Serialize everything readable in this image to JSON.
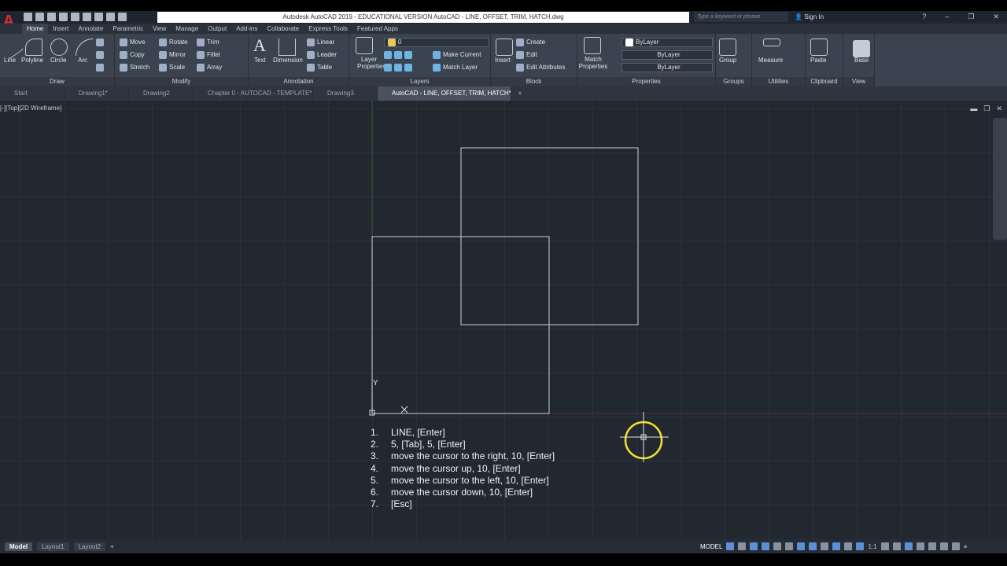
{
  "titlebar": {
    "doc_title": "Autodesk AutoCAD 2019 - EDUCATIONAL VERSION    AutoCAD - LINE, OFFSET, TRIM, HATCH.dwg",
    "search_placeholder": "Type a keyword or phrase",
    "signin": "Sign In",
    "app_logo": "A"
  },
  "ribbon_tabs": [
    "Home",
    "Insert",
    "Annotate",
    "Parametric",
    "View",
    "Manage",
    "Output",
    "Add-ins",
    "Collaborate",
    "Express Tools",
    "Featured Apps"
  ],
  "ribbon": {
    "draw": {
      "title": "Draw",
      "line": "Line",
      "polyline": "Polyline",
      "circle": "Circle",
      "arc": "Arc"
    },
    "modify": {
      "title": "Modify",
      "move": "Move",
      "rotate": "Rotate",
      "trim": "Trim",
      "copy": "Copy",
      "mirror": "Mirror",
      "fillet": "Fillet",
      "stretch": "Stretch",
      "scale": "Scale",
      "array": "Array"
    },
    "annotation": {
      "title": "Annotation",
      "text": "Text",
      "dimension": "Dimension",
      "linear": "Linear",
      "leader": "Leader",
      "table": "Table"
    },
    "layers": {
      "title": "Layers",
      "layer_properties": "Layer Properties",
      "layer_value": "0",
      "make_current": "Make Current",
      "match_layer": "Match Layer"
    },
    "block": {
      "title": "Block",
      "insert": "Insert",
      "create": "Create",
      "edit": "Edit",
      "edit_attributes": "Edit Attributes"
    },
    "properties": {
      "title": "Properties",
      "match_properties": "Match Properties",
      "color": "ByLayer",
      "linetype": "ByLayer",
      "lineweight": "ByLayer"
    },
    "groups": {
      "title": "Groups",
      "group": "Group"
    },
    "utilities": {
      "title": "Utilities",
      "measure": "Measure"
    },
    "clipboard": {
      "title": "Clipboard",
      "paste": "Paste"
    },
    "view": {
      "title": "View",
      "base": "Base"
    }
  },
  "file_tabs": [
    "Start",
    "Drawing1*",
    "Drawing2",
    "Chapter 0 - AUTOCAD - TEMPLATE*",
    "Drawing3",
    "AutoCAD - LINE, OFFSET, TRIM, HATCH*"
  ],
  "viewport": {
    "label": "[-][Top][2D Wireframe]"
  },
  "ucs": {
    "y": "Y"
  },
  "steps": [
    {
      "num": "1.",
      "text": "LINE, [Enter]"
    },
    {
      "num": "2.",
      "text": "5, [Tab], 5, [Enter]"
    },
    {
      "num": "3.",
      "text": "move the cursor to the right, 10, [Enter]"
    },
    {
      "num": "4.",
      "text": "move the cursor up, 10, [Enter]"
    },
    {
      "num": "5.",
      "text": "move the cursor to the left, 10, [Enter]"
    },
    {
      "num": "6.",
      "text": "move the cursor down, 10, [Enter]"
    },
    {
      "num": "7.",
      "text": "[Esc]"
    }
  ],
  "layout_tabs": [
    "Model",
    "Layout1",
    "Layout2"
  ],
  "status": {
    "model": "MODEL",
    "scale": "1:1"
  }
}
